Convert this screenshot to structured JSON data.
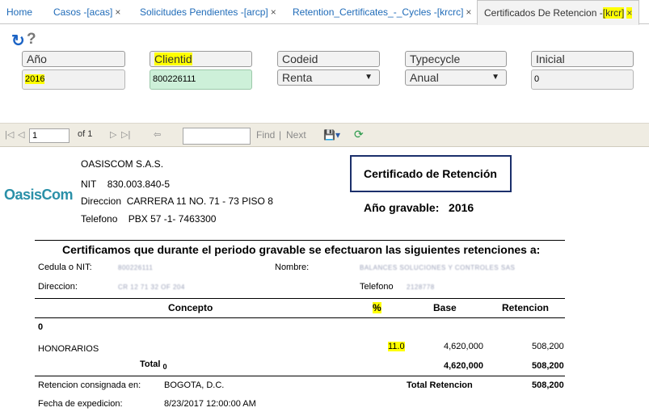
{
  "tabs": [
    {
      "label": "Home"
    },
    {
      "label": "Casos -[acas]",
      "close": "×"
    },
    {
      "label": "Solicitudes Pendientes -[arcp]",
      "close": "×"
    },
    {
      "label": "Retention_Certificates_-_Cycles -[krcrc]",
      "close": "×"
    },
    {
      "label_prefix": "Certificados De Retencion -",
      "label_code": "[krcr]",
      "close": "×"
    }
  ],
  "toolbar": {
    "refresh_icon": "↻",
    "help_icon": "?"
  },
  "filters": {
    "ano": {
      "label": "Año",
      "value": "2016"
    },
    "clientid": {
      "label": "Clientid",
      "value": "800226111"
    },
    "codeid": {
      "label": "Codeid",
      "value": "Renta"
    },
    "typecycle": {
      "label": "Typecycle",
      "value": "Anual"
    },
    "inicial": {
      "label": "Inicial",
      "value": "0"
    }
  },
  "report_toolbar": {
    "first": "|◁",
    "prev": "◁",
    "page": "1",
    "of_label": "of 1",
    "next": "▷",
    "last": "▷|",
    "back": "⇦",
    "find": "Find",
    "sep": "|",
    "next_link": "Next",
    "save_icon": "💾▾",
    "refresh_icon": "⟳"
  },
  "company": {
    "logo": "OasisCom",
    "name": "OASISCOM S.A.S.",
    "nit_label": "NIT",
    "nit": "830.003.840-5",
    "dir_label": "Direccion",
    "dir": "CARRERA  11 NO. 71 - 73 PISO 8",
    "tel_label": "Telefono",
    "tel": "PBX 57 -1- 7463300"
  },
  "certificate": {
    "title": "Certificado de Retención",
    "year_label": "Año gravable:",
    "year": "2016",
    "intro": "Certificamos que durante el periodo gravable se efectuaron las siguientes retenciones a:",
    "cedula_label": "Cedula o NIT:",
    "cedula_value": "800226111",
    "nombre_label": "Nombre:",
    "nombre_value": "BALANCES SOLUCIONES Y CONTROLES SAS",
    "direccion_label": "Direccion:",
    "direccion_value": "CR 12 71 32 OF 204",
    "telefono_label": "Telefono",
    "telefono_value": "2128778",
    "col_concepto": "Concepto",
    "col_pct": "%",
    "col_base": "Base",
    "col_retencion": "Retencion",
    "group": "0",
    "row": {
      "concepto": "HONORARIOS",
      "pct": "11.0",
      "base": "4,620,000",
      "retencion": "508,200"
    },
    "total_label": "Total",
    "total_sub": "0",
    "total_base": "4,620,000",
    "total_ret": "508,200",
    "consig_label": "Retencion consignada en:",
    "consig_value": "BOGOTA, D.C.",
    "total_ret_label": "Total Retencion",
    "total_ret_value": "508,200",
    "fecha_label": "Fecha de expedicion:",
    "fecha_value": "8/23/2017 12:00:00 AM"
  }
}
